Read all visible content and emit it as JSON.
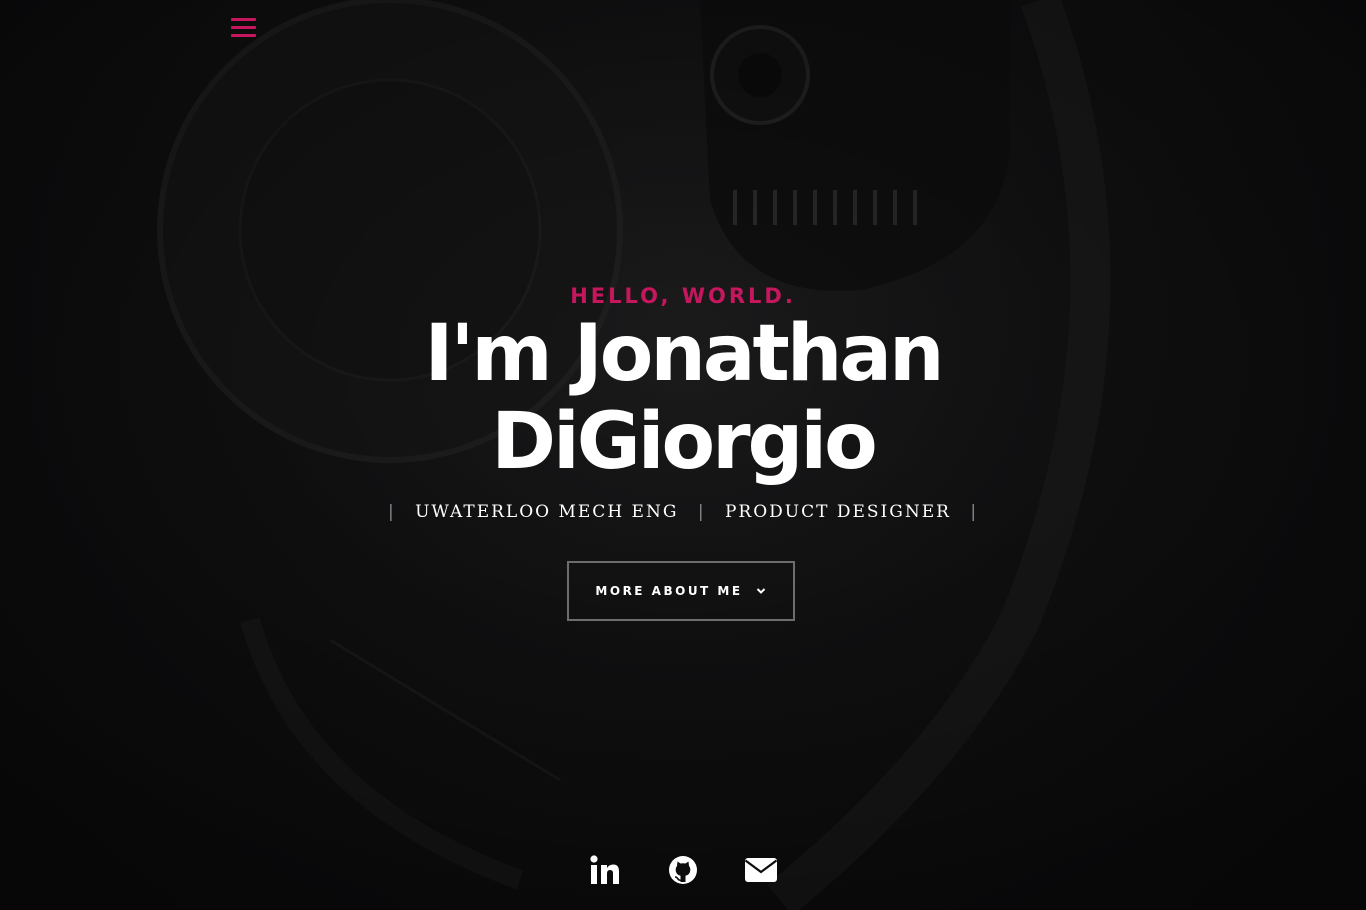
{
  "nav": {
    "menu_icon": "hamburger-menu-icon",
    "accent_color": "#c6175e"
  },
  "intro": {
    "greeting": "HELLO, WORLD.",
    "name_line1": "I'm Jonathan",
    "name_line2": "DiGiorgio",
    "roles": [
      "UWATERLOO MECH ENG",
      "PRODUCT DESIGNER"
    ],
    "separator": "|"
  },
  "cta": {
    "label": "MORE ABOUT ME",
    "icon": "chevron-down-icon"
  },
  "social": [
    {
      "icon": "linkedin-icon"
    },
    {
      "icon": "github-icon"
    },
    {
      "icon": "envelope-icon"
    }
  ],
  "colors": {
    "background": "#0d0d0e",
    "accent": "#c6175e",
    "text": "#ffffff"
  }
}
